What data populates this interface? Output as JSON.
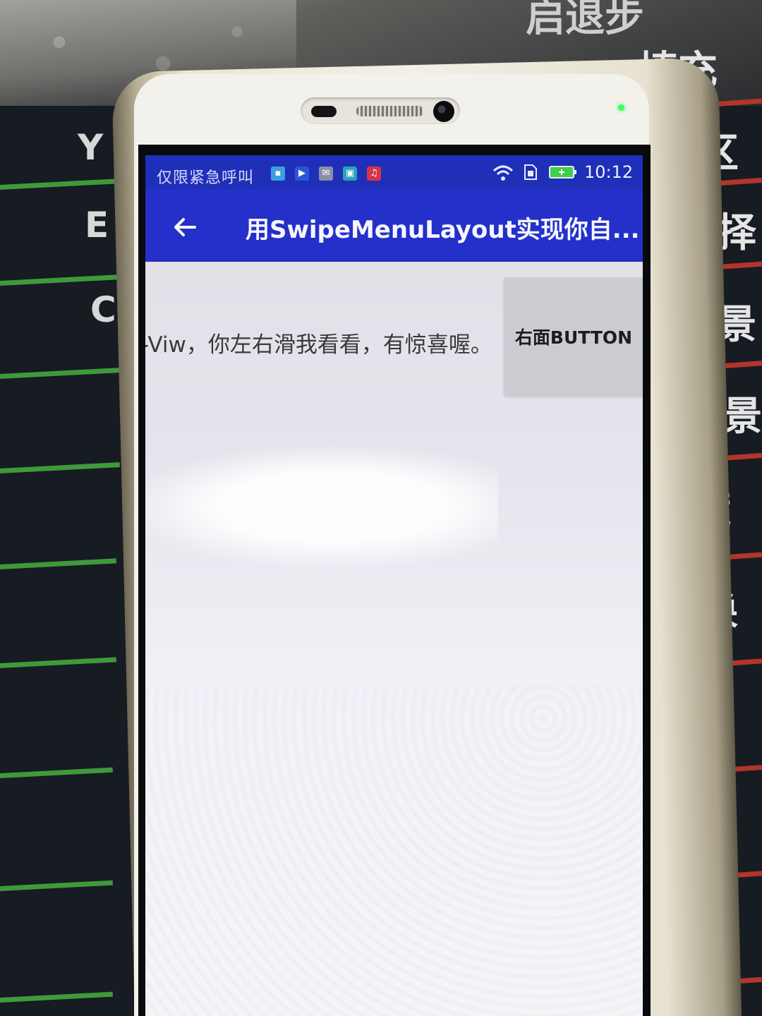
{
  "status_bar": {
    "carrier_text": "仅限紧急呼叫",
    "time": "10:12",
    "notification_icons": [
      "app-icon",
      "play-icon",
      "mail-icon",
      "image-icon",
      "music-icon"
    ]
  },
  "toolbar": {
    "title": "用SwipeMenuLayout实现你自..."
  },
  "list": {
    "row_text": "-Viw，你左右滑我看看，有惊喜喔。",
    "right_button_label": "右面BUTTON"
  },
  "background": {
    "monitor_words": [
      "启退步",
      "填充",
      "选区",
      "选择",
      "前景",
      "背景",
      "藏",
      "换"
    ],
    "monitor_letters": [
      "Y",
      "E",
      "C"
    ]
  },
  "colors": {
    "status_bar": "#1f2fb8",
    "toolbar": "#2430c9",
    "menu_button": "#cdcbd1",
    "content_bg": "#f0eff5"
  }
}
